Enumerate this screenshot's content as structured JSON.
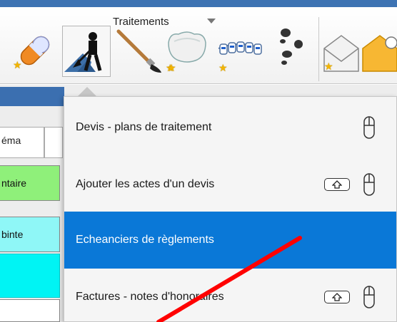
{
  "ribbon": {
    "group_title": "Traitements"
  },
  "icons": {
    "tool1": "pill-icon",
    "tool2": "worker-shovel-icon",
    "tool3": "paintbrush-icon",
    "tool4": "crown-tooth-icon",
    "tool5": "braces-icon",
    "tool6": "footprints-icon",
    "tool7": "envelope-icon"
  },
  "side": {
    "tab_label": "éma",
    "cells": [
      "ntaire",
      "binte",
      "",
      ""
    ]
  },
  "menu": {
    "items": [
      {
        "label": "Devis - plans de traitement",
        "highlighted": false,
        "shift": false
      },
      {
        "label": "Ajouter les actes d'un devis",
        "highlighted": false,
        "shift": true
      },
      {
        "label": "Echeanciers de règlements",
        "highlighted": true,
        "shift": false
      },
      {
        "label": "Factures - notes d'honoraires",
        "highlighted": false,
        "shift": true
      }
    ]
  },
  "colors": {
    "highlight": "#0a78d7",
    "annotation": "#ff0000",
    "cell_green": "#8ff07a",
    "cell_cyan": "#8ff7f7",
    "cell_cyan_strong": "#00f4f4"
  }
}
